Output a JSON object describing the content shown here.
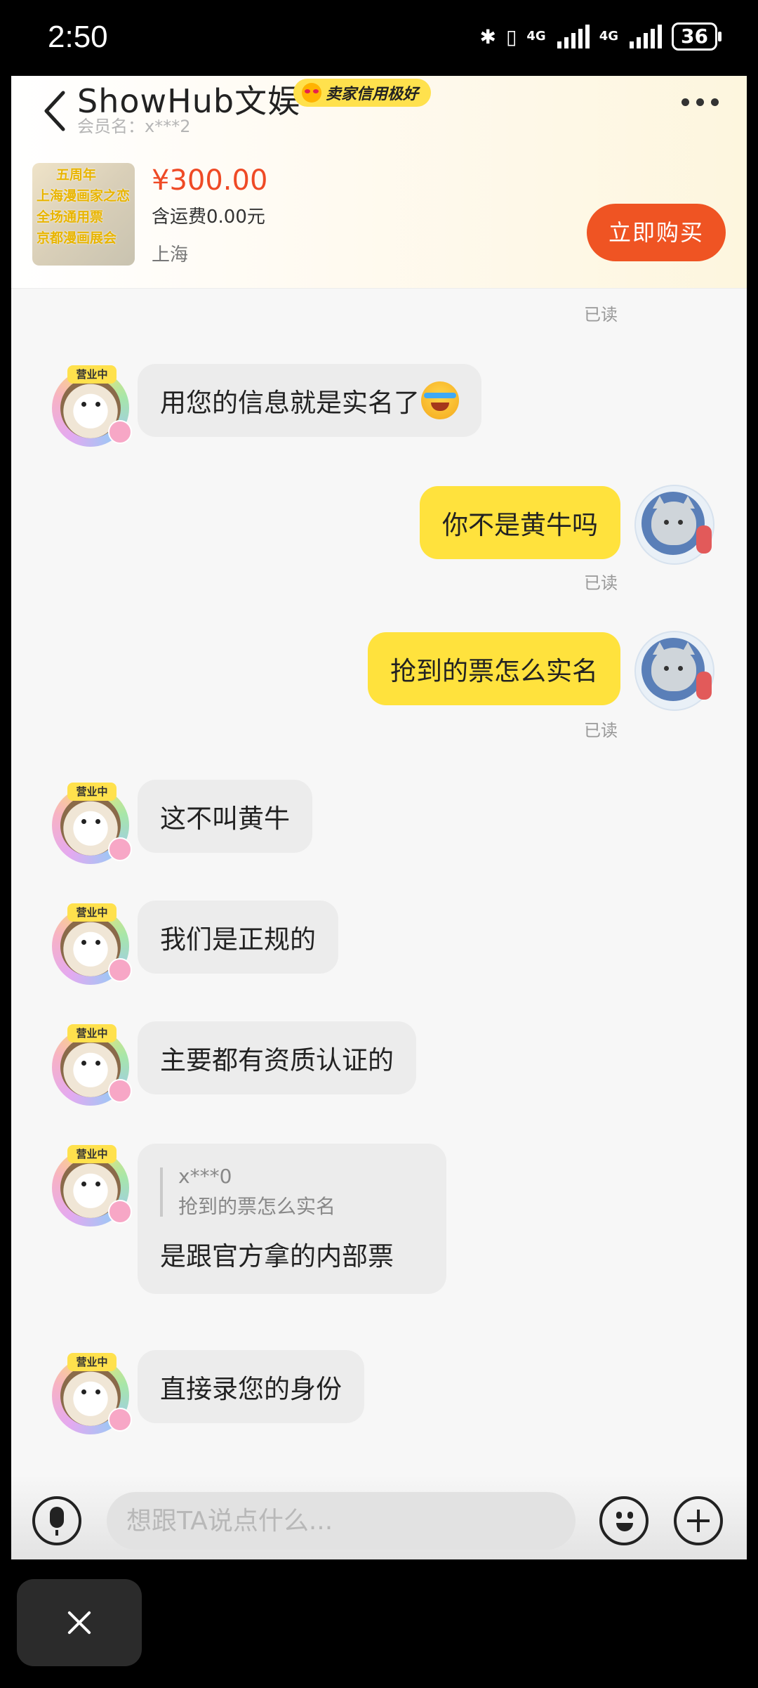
{
  "status_bar": {
    "time": "2:50",
    "network_1": "4G",
    "network_2": "4G",
    "battery": "36"
  },
  "header": {
    "shop_name": "ShowHub文娱",
    "credit_badge": "卖家信用极好",
    "member_label": "会员名：x***2",
    "product": {
      "image_lines": [
        "五周年",
        "上海漫画家之恋",
        "全场通用票",
        "京都漫画展会"
      ],
      "price": "¥300.00",
      "shipping": "含运费0.00元",
      "location": "上海"
    },
    "buy_button": "立即购买"
  },
  "avatar_tag": "营业中",
  "read_label": "已读",
  "messages": [
    {
      "side": "in",
      "text": "用您的信息就是实名了"
    },
    {
      "side": "out",
      "text": "你不是黄牛吗"
    },
    {
      "side": "out",
      "text": "抢到的票怎么实名"
    },
    {
      "side": "in",
      "text": "这不叫黄牛"
    },
    {
      "side": "in",
      "text": "我们是正规的"
    },
    {
      "side": "in",
      "text": "主要都有资质认证的"
    },
    {
      "side": "in",
      "quote_user": "x***0",
      "quote_text": "抢到的票怎么实名",
      "text": "是跟官方拿的内部票"
    },
    {
      "side": "in",
      "text": "直接录您的身份"
    }
  ],
  "input": {
    "placeholder": "想跟TA说点什么..."
  },
  "icons": [
    "back-icon",
    "more-icon",
    "laughing-crying-emoji-icon",
    "microphone-icon",
    "emoji-icon",
    "plus-icon",
    "close-icon",
    "bluetooth-icon",
    "signal-icon",
    "battery-icon"
  ],
  "colors": {
    "accent_orange": "#ef5423",
    "price_red": "#ef4a25",
    "outgoing_bubble": "#ffe23d",
    "incoming_bubble": "#ececec",
    "credit_badge": "#ffe14d"
  }
}
